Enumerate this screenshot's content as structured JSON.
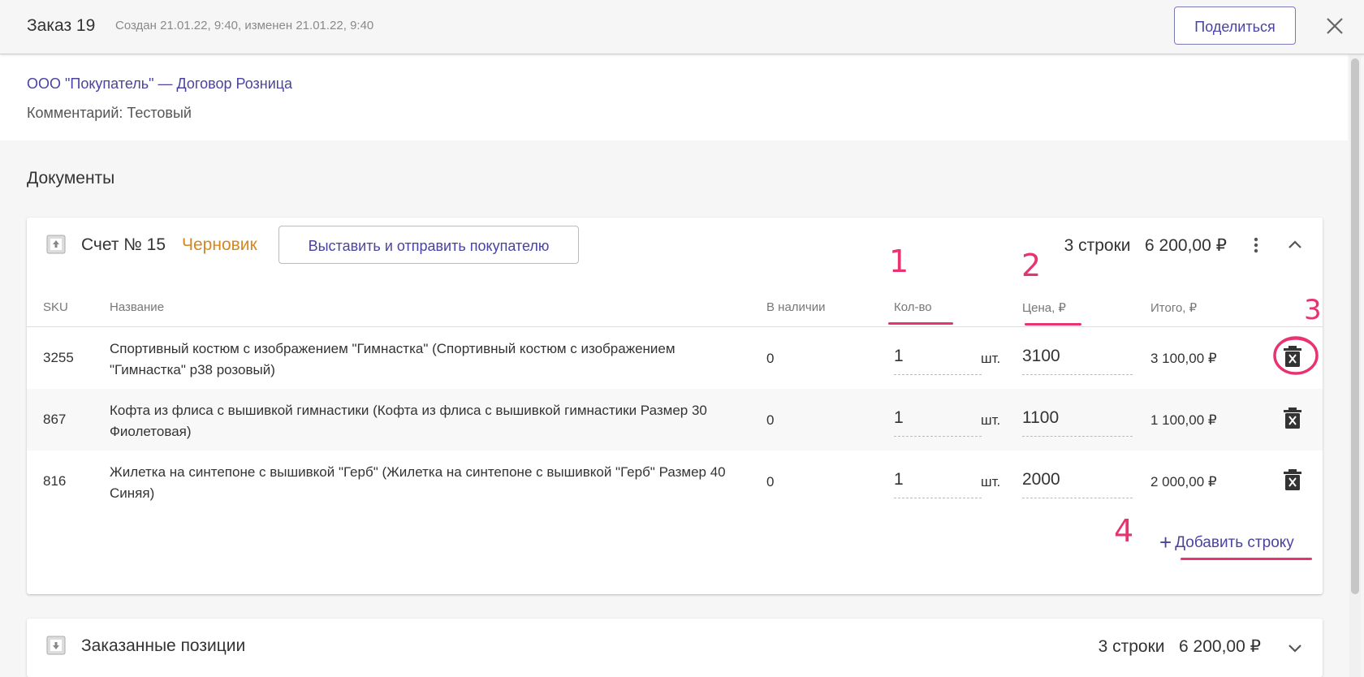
{
  "header": {
    "order_title": "Заказ 19",
    "meta": "Создан 21.01.22, 9:40, изменен 21.01.22, 9:40",
    "share_label": "Поделиться"
  },
  "info": {
    "buyer_link": "ООО \"Покупатель\" — Договор Розница",
    "comment": "Комментарий: Тестовый"
  },
  "documents_title": "Документы",
  "invoice": {
    "title": "Счет № 15",
    "status": "Черновик",
    "send_button": "Выставить и отправить покупателю",
    "rows_count": "3 строки",
    "sum": "6 200,00 ₽",
    "columns": {
      "sku": "SKU",
      "name": "Название",
      "stock": "В наличии",
      "qty": "Кол-во",
      "price": "Цена, ₽",
      "total": "Итого, ₽"
    },
    "rows": [
      {
        "sku": "3255",
        "name": "Спортивный костюм с изображением \"Гимнастка\" (Спортивный костюм с изображением \"Гимнастка\" р38 розовый)",
        "stock": "0",
        "qty": "1",
        "unit": "шт.",
        "price": "3100",
        "total": "3 100,00 ₽"
      },
      {
        "sku": "867",
        "name": "Кофта из флиса с вышивкой гимнастики (Кофта из флиса с вышивкой гимнастики Размер 30 Фиолетовая)",
        "stock": "0",
        "qty": "1",
        "unit": "шт.",
        "price": "1100",
        "total": "1 100,00 ₽"
      },
      {
        "sku": "816",
        "name": "Жилетка на синтепоне с вышивкой \"Герб\" (Жилетка на синтепоне с вышивкой \"Герб\" Размер 40 Синяя)",
        "stock": "0",
        "qty": "1",
        "unit": "шт.",
        "price": "2000",
        "total": "2 000,00 ₽"
      }
    ],
    "add_row_label": "Добавить строку"
  },
  "ordered": {
    "title": "Заказанные позиции",
    "rows_count": "3 строки",
    "sum": "6 200,00 ₽"
  },
  "annotations": {
    "n1": "1",
    "n2": "2",
    "n3": "3",
    "n4": "4",
    "color": "#e8336f"
  },
  "colors": {
    "accent": "#4a43a0",
    "draft_status": "#d4881f"
  }
}
